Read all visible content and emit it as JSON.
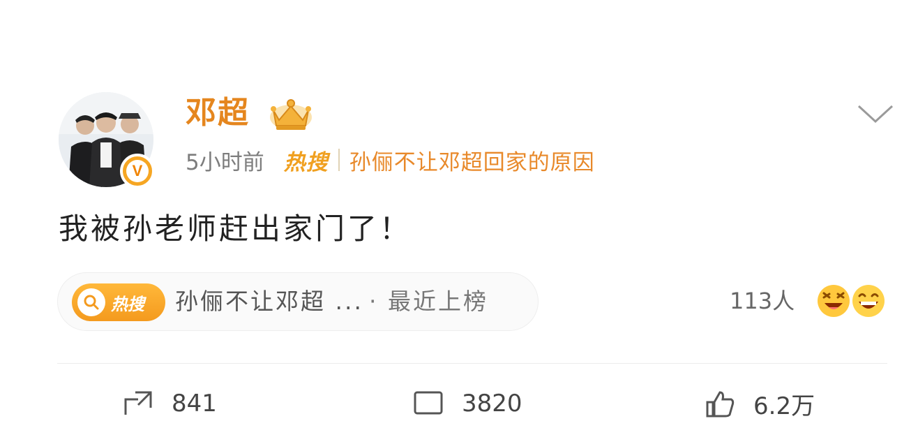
{
  "post": {
    "user": {
      "name": "邓超"
    },
    "time": "5小时前",
    "hot_tag": "热搜",
    "hot_topic": "孙俪不让邓超回家的原因",
    "text": "我被孙老师赶出家门了！",
    "hot_card": {
      "badge": "热搜",
      "topic": "孙俪不让邓超 ...",
      "rank_text": "· 最近上榜"
    },
    "reactions_people": "113人",
    "actions": {
      "repost_count": "841",
      "comment_count": "3820",
      "like_count": "6.2万"
    }
  },
  "icons": [
    "chevron-down-icon",
    "crown-icon",
    "verified-badge-icon",
    "search-icon",
    "laughing-emoji-icon",
    "grinning-emoji-icon",
    "repost-icon",
    "comment-icon",
    "like-icon"
  ],
  "colors": {
    "brand_orange": "#e5861e",
    "hot_orange": "#f0a020",
    "text_dark": "#222222",
    "text_gray": "#7d7d7d"
  }
}
